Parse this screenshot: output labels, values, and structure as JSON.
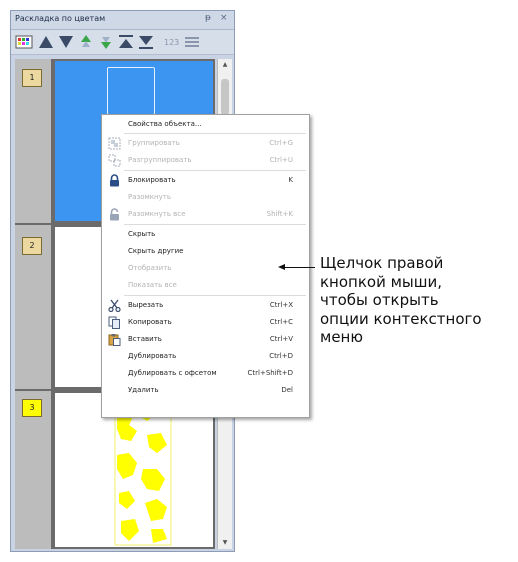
{
  "panel": {
    "title": "Раскладка по цветам",
    "controls": {
      "pin": "ᵽ",
      "close": "×"
    },
    "toolbar": [
      {
        "name": "color-grid-icon"
      },
      {
        "name": "move-up-icon"
      },
      {
        "name": "move-down-icon"
      },
      {
        "name": "move-up-one-icon"
      },
      {
        "name": "move-down-one-icon"
      },
      {
        "name": "move-to-top-icon"
      },
      {
        "name": "move-to-bottom-icon"
      },
      {
        "name": "renumber-icon"
      },
      {
        "name": "list-view-icon"
      }
    ],
    "rows": [
      {
        "number": "1",
        "badge_color": "#ecd99f",
        "thumb_color": "#3c95f0"
      },
      {
        "number": "2",
        "badge_color": "#ecd99f",
        "thumb_color": "#ffffff"
      },
      {
        "number": "3",
        "badge_color": "#ffff00",
        "thumb_color": "#ffff00"
      }
    ]
  },
  "context_menu": {
    "items": [
      {
        "label": "Свойства объекта...",
        "shortcut": "",
        "enabled": true,
        "icon": null
      },
      {
        "label": "Группировать",
        "shortcut": "Ctrl+G",
        "enabled": false,
        "icon": "group-icon"
      },
      {
        "label": "Разгруппировать",
        "shortcut": "Ctrl+U",
        "enabled": false,
        "icon": "ungroup-icon"
      },
      {
        "label": "Блокировать",
        "shortcut": "K",
        "enabled": true,
        "icon": "lock-icon"
      },
      {
        "label": "Разомкнуть",
        "shortcut": "",
        "enabled": false,
        "icon": null
      },
      {
        "label": "Разомкнуть все",
        "shortcut": "Shift+K",
        "enabled": false,
        "icon": "unlock-icon"
      },
      {
        "label": "Скрыть",
        "shortcut": "",
        "enabled": true,
        "icon": null
      },
      {
        "label": "Скрыть другие",
        "shortcut": "",
        "enabled": true,
        "icon": null
      },
      {
        "label": "Отобразить",
        "shortcut": "",
        "enabled": false,
        "icon": null
      },
      {
        "label": "Показать все",
        "shortcut": "",
        "enabled": false,
        "icon": null
      },
      {
        "label": "Вырезать",
        "shortcut": "Ctrl+X",
        "enabled": true,
        "icon": "cut-icon"
      },
      {
        "label": "Копировать",
        "shortcut": "Ctrl+C",
        "enabled": true,
        "icon": "copy-icon"
      },
      {
        "label": "Вставить",
        "shortcut": "Ctrl+V",
        "enabled": true,
        "icon": "paste-icon"
      },
      {
        "label": "Дублировать",
        "shortcut": "Ctrl+D",
        "enabled": true,
        "icon": null
      },
      {
        "label": "Дублировать с офсетом",
        "shortcut": "Ctrl+Shift+D",
        "enabled": true,
        "icon": null
      },
      {
        "label": "Удалить",
        "shortcut": "Del",
        "enabled": true,
        "icon": null
      }
    ]
  },
  "callout": {
    "lines": [
      "Щелчок правой",
      "кнопкой мыши,",
      "чтобы открыть",
      "опции контекстного",
      "меню"
    ]
  },
  "colors": {
    "panel_bg": "#c9d3e3",
    "selection_blue": "#3c95f0",
    "badge_tan": "#ecd99f",
    "badge_yellow": "#ffff00"
  }
}
